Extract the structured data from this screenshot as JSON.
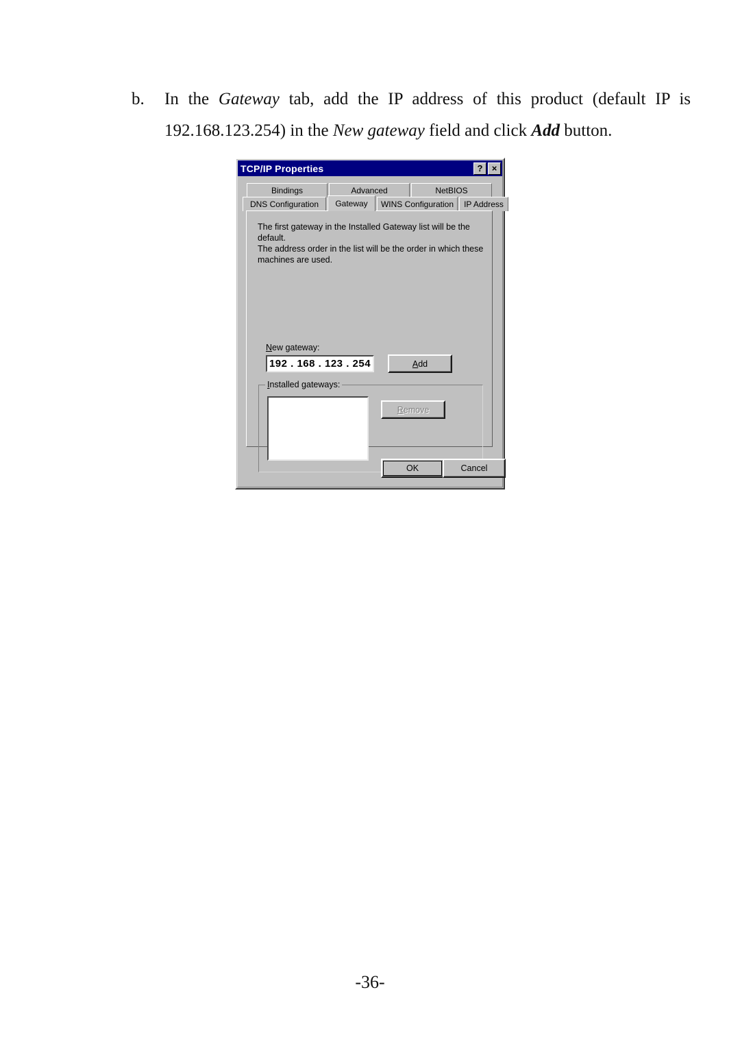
{
  "document": {
    "list_marker": "b.",
    "text_segments": [
      {
        "text": "In the ",
        "style": "normal"
      },
      {
        "text": "Gateway",
        "style": "italic"
      },
      {
        "text": " tab, add the IP address of this product (default IP is 192.168.123.254) in the ",
        "style": "normal"
      },
      {
        "text": "New gateway",
        "style": "italic"
      },
      {
        "text": " field and click ",
        "style": "normal"
      },
      {
        "text": "Add",
        "style": "bolditalic"
      },
      {
        "text": " button.",
        "style": "normal"
      }
    ],
    "page_number": "-36-"
  },
  "dialog": {
    "title": "TCP/IP Properties",
    "titlebar_color": "#000080",
    "face_color": "#c0c0c0",
    "help_button": "?",
    "close_button": "×",
    "tabs_row_top": [
      {
        "label": "Bindings",
        "selected": false
      },
      {
        "label": "Advanced",
        "selected": false
      },
      {
        "label": "NetBIOS",
        "selected": false
      }
    ],
    "tabs_row_bottom": [
      {
        "label": "DNS Configuration",
        "selected": false
      },
      {
        "label": "Gateway",
        "selected": true
      },
      {
        "label": "WINS Configuration",
        "selected": false
      },
      {
        "label": "IP Address",
        "selected": false
      }
    ],
    "panel": {
      "description_line1": "The first gateway in the Installed Gateway list will be the default.",
      "description_line2": "The address order in the list will be the order in which these",
      "description_line3": "machines are used.",
      "new_gateway_label_accel": "N",
      "new_gateway_label_rest": "ew gateway:",
      "new_gateway_value": "192 . 168 . 123 . 254",
      "new_gateway_placeholder": "   .   .   .   ",
      "add_button_accel": "A",
      "add_button_rest": "dd",
      "installed_gateways_legend_accel": "I",
      "installed_gateways_legend_rest": "nstalled gateways:",
      "installed_gateways_items": [],
      "remove_button_accel": "R",
      "remove_button_rest": "emove",
      "remove_button_enabled": false
    },
    "footer": {
      "ok_label": "OK",
      "cancel_label": "Cancel"
    }
  }
}
